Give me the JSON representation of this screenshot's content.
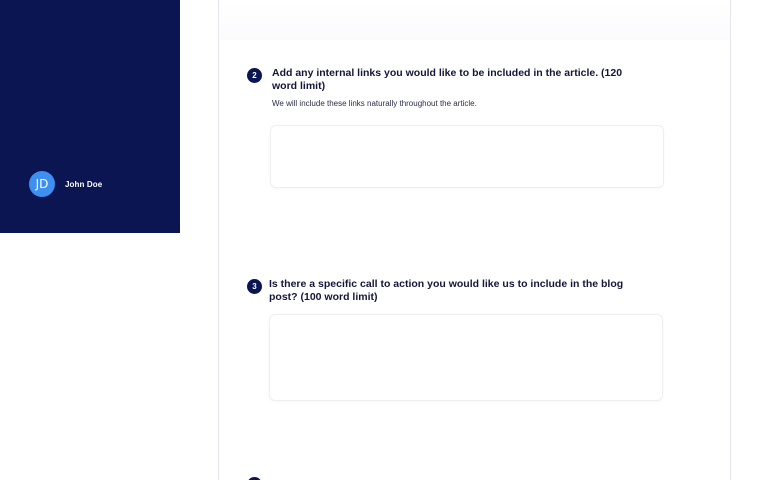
{
  "sidebar": {
    "user": {
      "initials": "JD",
      "name": "John Doe"
    }
  },
  "questions": [
    {
      "number": "2",
      "title": "Add any internal links you would like to be included in the article.  (120 word limit)",
      "help": "We will include these links naturally throughout the article.",
      "answer": ""
    },
    {
      "number": "3",
      "title": "Is there a specific call to action you would like us to include in the blog post? (100 word limit)",
      "help": "",
      "answer": ""
    }
  ],
  "colors": {
    "sidebar_bg": "#0b1552",
    "avatar_bg": "#3d8ff0",
    "badge_bg": "#0b1552"
  }
}
